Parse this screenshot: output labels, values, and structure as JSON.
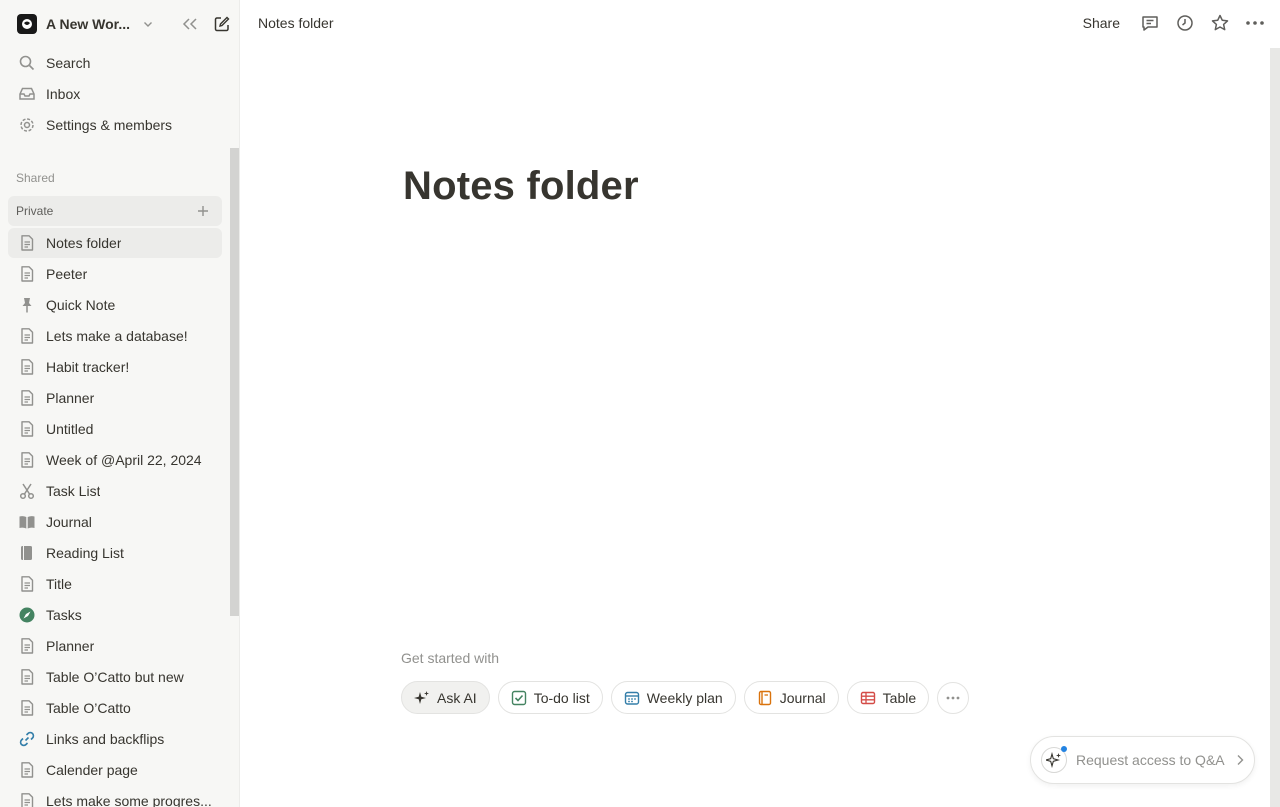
{
  "workspace": {
    "name": "A New Wor..."
  },
  "nav": [
    {
      "label": "Search",
      "icon": "search-icon"
    },
    {
      "label": "Inbox",
      "icon": "inbox-icon"
    },
    {
      "label": "Settings & members",
      "icon": "gear-icon"
    }
  ],
  "sections": {
    "shared": "Shared",
    "private": "Private"
  },
  "pages": [
    {
      "label": "Notes folder",
      "icon": "page-icon",
      "active": true
    },
    {
      "label": "Peeter",
      "icon": "page-icon"
    },
    {
      "label": "Quick Note",
      "icon": "pin-icon"
    },
    {
      "label": "Lets make a database!",
      "icon": "page-icon"
    },
    {
      "label": "Habit tracker!",
      "icon": "page-icon"
    },
    {
      "label": "Planner",
      "icon": "page-icon"
    },
    {
      "label": "Untitled",
      "icon": "page-icon"
    },
    {
      "label": "Week of @April 22, 2024",
      "icon": "page-icon"
    },
    {
      "label": "Task List",
      "icon": "scissors-icon"
    },
    {
      "label": "Journal",
      "icon": "open-book-icon"
    },
    {
      "label": "Reading List",
      "icon": "book-icon"
    },
    {
      "label": "Title",
      "icon": "page-icon"
    },
    {
      "label": "Tasks",
      "icon": "compass-icon"
    },
    {
      "label": "Planner",
      "icon": "page-icon"
    },
    {
      "label": "Table O’Catto but new",
      "icon": "page-icon"
    },
    {
      "label": "Table O’Catto",
      "icon": "page-icon"
    },
    {
      "label": "Links and backflips",
      "icon": "link-icon"
    },
    {
      "label": "Calender page",
      "icon": "page-icon"
    },
    {
      "label": "Lets make some progres...",
      "icon": "page-icon"
    }
  ],
  "topbar": {
    "breadcrumb": "Notes folder",
    "share": "Share"
  },
  "main": {
    "title": "Notes folder",
    "get_started": "Get started with",
    "chips": [
      {
        "label": "Ask AI",
        "icon": "sparkle-icon"
      },
      {
        "label": "To-do list",
        "icon": "checkbox-icon"
      },
      {
        "label": "Weekly plan",
        "icon": "calendar-icon"
      },
      {
        "label": "Journal",
        "icon": "notebook-icon"
      },
      {
        "label": "Table",
        "icon": "table-icon"
      }
    ]
  },
  "qa": {
    "label": "Request access to Q&A"
  },
  "colors": {
    "sidebar_bg": "#f7f7f5",
    "text": "#37352f",
    "muted": "#91918e",
    "accent_blue": "#2383e2"
  }
}
